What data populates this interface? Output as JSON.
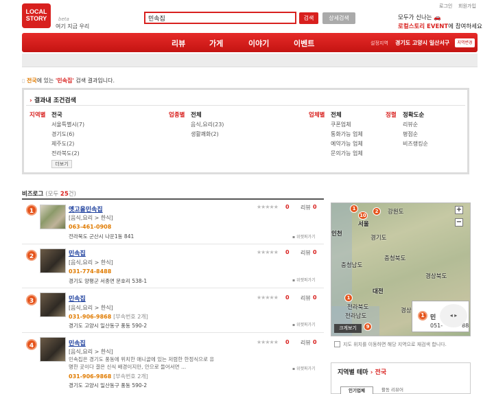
{
  "header": {
    "logo_line1": "LOCAL",
    "logo_line2": "STORY",
    "beta": "beta",
    "tagline": "여기 지금 우리",
    "search_value": "민속집",
    "search_button": "검색",
    "detail_search_button": "상세검색",
    "login": "로그인",
    "signup": "회원가입",
    "promo_line1": "모두가 신나는",
    "promo_line2_highlight": "로컬스토리 EVENT",
    "promo_line2_rest": "에 참여하세요"
  },
  "nav": {
    "items": [
      "리뷰",
      "가게",
      "이야기",
      "이벤트"
    ],
    "region_label": "설정지역",
    "region_value": "경기도 고양시 일산서구",
    "region_change": "지역변경"
  },
  "result": {
    "region": "전국",
    "mid1": "에 있는 ",
    "query": "'민속집'",
    "tail": " 검색 결과입니다."
  },
  "filter": {
    "title": "결과내 조건검색",
    "region": {
      "label": "지역별",
      "selected": "전국",
      "options": [
        "서울특별시(7)",
        "경기도(6)",
        "제주도(2)",
        "전라북도(2)"
      ],
      "more": "더보기"
    },
    "category": {
      "label": "업종별",
      "selected": "전체",
      "options": [
        "음식,요리(23)",
        "생활쾌화(2)"
      ]
    },
    "business": {
      "label": "업체별",
      "selected": "전체",
      "options": [
        "쿠폰업체",
        "통화가능 업체",
        "예약가능 업체",
        "문의가능 업체"
      ]
    },
    "sort": {
      "label": "정렬",
      "selected": "정확도순",
      "options": [
        "리뷰순",
        "평점순",
        "비즈랭킹순"
      ]
    }
  },
  "bizlog": {
    "title": "비즈로그",
    "count_prefix": "(모두 ",
    "count": "25",
    "count_suffix": "건)"
  },
  "list": [
    {
      "num": "1",
      "name": "옛고을민속집",
      "category": "[음식,요리 > 한식]",
      "phone": "063-461-0908",
      "phone_extra": "",
      "address": "전라북도 군산시 나운1동 841",
      "desc": "",
      "stars": "★★★★★",
      "score": "0",
      "review_label": "리뷰",
      "review_count": "0",
      "wish": "위젯퍼가기"
    },
    {
      "num": "2",
      "name": "민속집",
      "category": "[음식,요리 > 한식]",
      "phone": "031-774-8488",
      "phone_extra": "",
      "address": "경기도 양평군 서종면 문호리 538-1",
      "desc": "",
      "stars": "★★★★★",
      "score": "0",
      "review_label": "리뷰",
      "review_count": "0",
      "wish": "위젯퍼가기"
    },
    {
      "num": "3",
      "name": "민속집",
      "category": "[음식,요리 > 한식]",
      "phone": "031-906-9868",
      "phone_extra": "[부속번호 2개]",
      "address": "경기도 고양시 일산동구 풍동 590-2",
      "desc": "",
      "stars": "★★★★★",
      "score": "0",
      "review_label": "리뷰",
      "review_count": "0",
      "wish": "위젯퍼가기"
    },
    {
      "num": "4",
      "name": "민속집",
      "category": "[음식,요리 > 한식]",
      "phone": "031-906-9868",
      "phone_extra": "[부속번호 2개]",
      "address": "경기도 고양시 일산동구 풍동 590-2",
      "desc": "민속집은 경기도 풍동에 위치한 애니골에 있는 저렴한 한정식으로 유명한 곳이다 결은 신식 배경이지만, 안으로 들어서면 ...",
      "stars": "★★★★★",
      "score": "0",
      "review_label": "리뷰",
      "review_count": "0",
      "wish": "위젯퍼가기"
    }
  ],
  "map": {
    "labels": [
      "강원도",
      "서울",
      "인천",
      "경기도",
      "충청북도",
      "충청남도",
      "경상북도",
      "대전",
      "전라북도",
      "전라남도",
      "경상남도"
    ],
    "pins": [
      "1",
      "2",
      "10",
      "1",
      "9"
    ],
    "bigview": "크게보기",
    "popup_num": "1",
    "popup_name": "민",
    "popup_phone": "051-",
    "popup_tail": "88",
    "note": "지도 위치를 이동하면 해당 지역으로 재검색 합니다."
  },
  "theme": {
    "title": "지역별 테마",
    "arrow": "›",
    "region": "전국",
    "tab1": "인기업체",
    "tab2": "활동 리뷰어"
  },
  "colors": {
    "brand": "#d8201e",
    "accent": "#e07b00",
    "link": "#1a3d9c"
  }
}
